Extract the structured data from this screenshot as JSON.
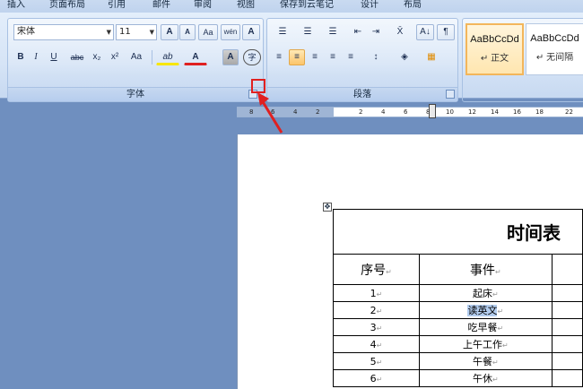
{
  "tabs": [
    "插入",
    "页面布局",
    "引用",
    "邮件",
    "审阅",
    "视图",
    "保存到云笔记",
    "设计",
    "布局"
  ],
  "font_group": {
    "font_name": "宋体",
    "font_size": "11",
    "label": "字体",
    "row1": [
      "A",
      "A",
      "Aa",
      "wén",
      "A"
    ],
    "row2": [
      "B",
      "I",
      "U",
      "abc",
      "x₂",
      "x²",
      "Aa",
      "ab",
      "A",
      "A",
      "字"
    ]
  },
  "para_group": {
    "label": "段落",
    "row1": [
      "☰",
      "☰",
      "☰",
      "⇤",
      "⇥",
      "X̄",
      "A↓",
      "¶"
    ],
    "row2": [
      "≡",
      "≡",
      "≡",
      "≡",
      "≡",
      "↕",
      "◈",
      "▦"
    ]
  },
  "styles": [
    {
      "preview": "AaBbCcDd",
      "name": "↵ 正文",
      "selected": true
    },
    {
      "preview": "AaBbCcDd",
      "name": "↵ 无间隔",
      "selected": false
    }
  ],
  "ruler_ticks": [
    "8",
    "6",
    "4",
    "2",
    "2",
    "4",
    "6",
    "8",
    "10",
    "12",
    "14",
    "16",
    "18",
    "22"
  ],
  "table": {
    "title": "时间表",
    "headers": [
      "序号",
      "事件"
    ],
    "rows": [
      [
        "1",
        "起床"
      ],
      [
        "2",
        "读英文"
      ],
      [
        "3",
        "吃早餐"
      ],
      [
        "4",
        "上午工作"
      ],
      [
        "5",
        "午餐"
      ],
      [
        "6",
        "午休"
      ]
    ]
  },
  "colors": {
    "highlight": "#b3cdef",
    "accent_arrow": "#e02020"
  }
}
